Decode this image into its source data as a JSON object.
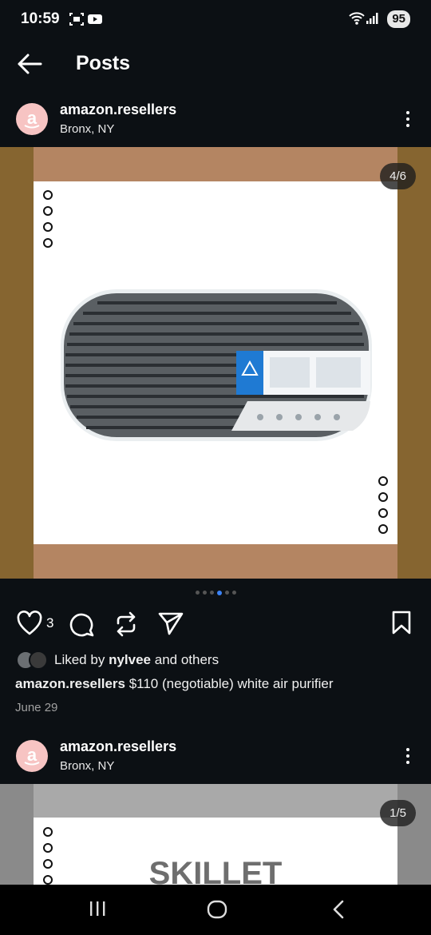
{
  "status_bar": {
    "time": "10:59",
    "battery": "95"
  },
  "header": {
    "title": "Posts"
  },
  "posts": [
    {
      "username": "amazon.resellers",
      "location": "Bronx, NY",
      "counter": "4/6",
      "likes": "3",
      "liked_prefix": "Liked by",
      "liked_user": "nylvee",
      "liked_suffix": "and others",
      "caption_user": "amazon.resellers",
      "caption_text": "$110 (negotiable) white air purifier",
      "date": "June 29"
    },
    {
      "username": "amazon.resellers",
      "location": "Bronx, NY",
      "counter": "1/5",
      "image_text": "SKILLET"
    }
  ],
  "colors": {
    "accent": "#3b82f6",
    "avatar_bg": "#f7c4c3",
    "background": "#0c1014"
  }
}
